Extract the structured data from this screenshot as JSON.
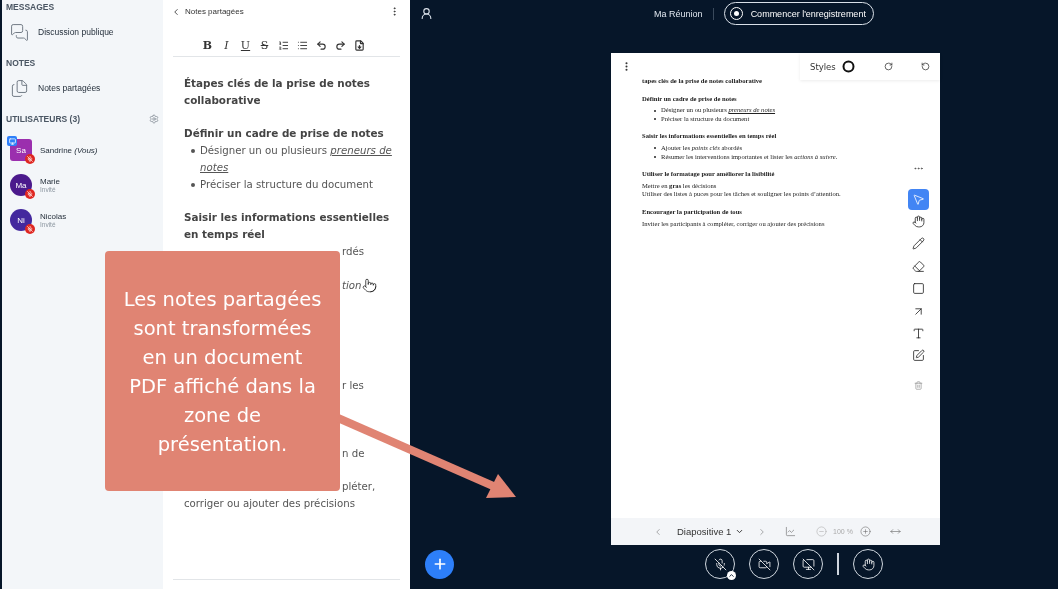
{
  "sidebar": {
    "sections": [
      {
        "title": "MESSAGES",
        "items": [
          {
            "kind": "chat",
            "label": "Discussion publique"
          }
        ]
      },
      {
        "title": "NOTES",
        "items": [
          {
            "kind": "notes",
            "label": "Notes partagées"
          }
        ]
      }
    ],
    "users_title": "UTILISATEURS (3)",
    "users": [
      {
        "initials": "Sa",
        "name": "Sandrine *(Vous)*",
        "presenter": true,
        "muted": true,
        "color": "#9b2fae"
      },
      {
        "initials": "Ma",
        "name": "Marie",
        "role": "Invité",
        "presenter": false,
        "muted": true,
        "color": "#4b1a8c"
      },
      {
        "initials": "Ni",
        "name": "Nicolas",
        "role": "Invité",
        "presenter": false,
        "muted": true,
        "color": "#43289e"
      }
    ]
  },
  "notes": {
    "title": "Notes partagées",
    "format_buttons": [
      {
        "kind": "bold",
        "label": "B"
      },
      {
        "kind": "italic",
        "label": "I"
      },
      {
        "kind": "underline",
        "label": "U"
      },
      {
        "kind": "strike",
        "label": "S"
      }
    ],
    "content": [
      {
        "kind": "heading",
        "text": "Étapes clés de la prise de notes collaborative"
      },
      {
        "kind": "heading",
        "text": "Définir un cadre de prise de notes"
      },
      {
        "kind": "bullet",
        "text": "Désigner un ou plusieurs *preneurs de notes*",
        "underline_emphasis": true
      },
      {
        "kind": "bullet",
        "text": "Préciser la structure du document"
      },
      {
        "kind": "heading",
        "text": "Saisir les informations essentielles en temps réel"
      },
      {
        "kind": "fragment",
        "text": "rdés"
      },
      {
        "kind": "fragment",
        "text": "*tion*",
        "cursor": true
      },
      {
        "kind": "fragment",
        "text": "r les"
      },
      {
        "kind": "fragment",
        "text": "n de"
      },
      {
        "kind": "fragment",
        "text": "pléter,"
      },
      {
        "kind": "text",
        "text": "corriger ou ajouter des précisions"
      }
    ]
  },
  "topbar": {
    "meeting_title": "Ma Réunion",
    "record_button": "Commencer l'enregistrement"
  },
  "slide": {
    "styles_label": "Styles",
    "lines": [
      {
        "kind": "heading",
        "text": "tapes clés de la prise de notes collaborative"
      },
      {
        "kind": "heading",
        "text": "Définir un cadre de prise de notes"
      },
      {
        "kind": "bullet",
        "text": "Désigner un ou plusieurs *preneurs de notes*",
        "underline_emphasis": true
      },
      {
        "kind": "bullet",
        "text": "Préciser la structure du document"
      },
      {
        "kind": "heading",
        "text": "Saisir les informations essentielles en temps réel"
      },
      {
        "kind": "bullet",
        "text": "Ajouter les *points clés* abordés"
      },
      {
        "kind": "bullet",
        "text": "Résumer les interventions importantes et lister les *actions à suivre*."
      },
      {
        "kind": "heading",
        "text": "Utiliser le formatage pour améliorer la lisibilité"
      },
      {
        "kind": "text",
        "text": "Mettre en **gras** les décisions"
      },
      {
        "kind": "text",
        "text": "Utiliser des listes à puces pour les tâches et souligner les points d’attention."
      },
      {
        "kind": "heading",
        "text": "Encourager la participation de tous"
      },
      {
        "kind": "text",
        "text": "Inviter les participants à compléter, corriger ou ajouter des précisions"
      }
    ],
    "tools": [
      {
        "kind": "select",
        "selected": true
      },
      {
        "kind": "hand",
        "selected": false
      },
      {
        "kind": "pencil",
        "selected": false
      },
      {
        "kind": "eraser",
        "selected": false
      },
      {
        "kind": "rectangle",
        "selected": false
      },
      {
        "kind": "arrow",
        "selected": false
      },
      {
        "kind": "text",
        "selected": false
      },
      {
        "kind": "note",
        "selected": false
      }
    ],
    "slide_label": "Diapositive 1",
    "zoom": "100 %"
  },
  "callout": {
    "text": "Les notes partagées sont transformées en un document PDF affiché dans la zone de présentation."
  }
}
